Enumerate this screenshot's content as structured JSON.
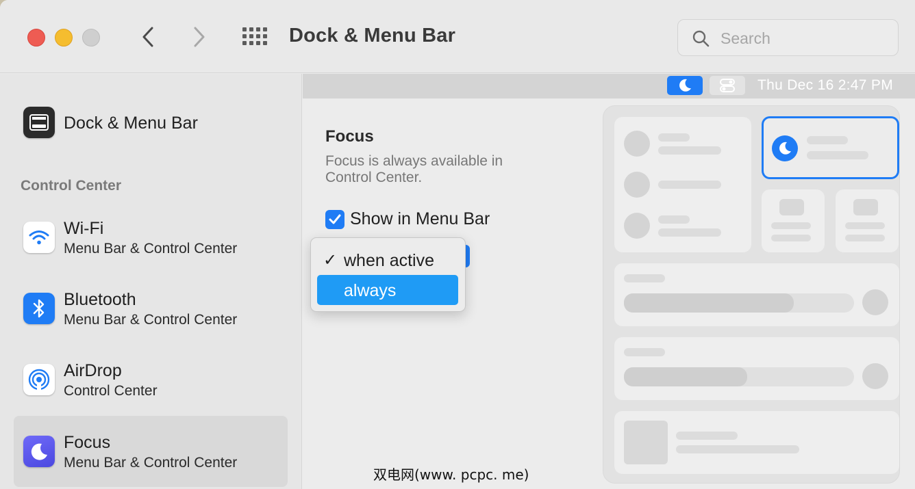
{
  "window": {
    "title": "Dock & Menu Bar",
    "search_placeholder": "Search"
  },
  "sidebar": {
    "top_item": {
      "label": "Dock & Menu Bar",
      "icon": "dock-menubar-icon"
    },
    "section_label": "Control Center",
    "items": [
      {
        "title": "Wi-Fi",
        "subtitle": "Menu Bar & Control Center",
        "icon": "wifi-icon"
      },
      {
        "title": "Bluetooth",
        "subtitle": "Menu Bar & Control Center",
        "icon": "bluetooth-icon"
      },
      {
        "title": "AirDrop",
        "subtitle": "Control Center",
        "icon": "airdrop-icon"
      },
      {
        "title": "Focus",
        "subtitle": "Menu Bar & Control Center",
        "icon": "focus-moon-icon",
        "selected": true
      }
    ]
  },
  "menubar_preview": {
    "date_time": "Thu Dec 16  2:47 PM"
  },
  "focus_settings": {
    "heading": "Focus",
    "description": "Focus is always available in Control Center.",
    "show_in_menu_bar": {
      "label": "Show in Menu Bar",
      "checked": true
    },
    "dropdown": {
      "options": [
        {
          "label": "when active",
          "checked": true
        },
        {
          "label": "always",
          "highlighted": true
        }
      ]
    }
  },
  "colors": {
    "accent": "#1f7cf5",
    "highlight": "#1f9bf5",
    "close": "#ee5c53",
    "minimize": "#f5bd2f"
  },
  "watermark": "双电网(www. pcpc. me)"
}
